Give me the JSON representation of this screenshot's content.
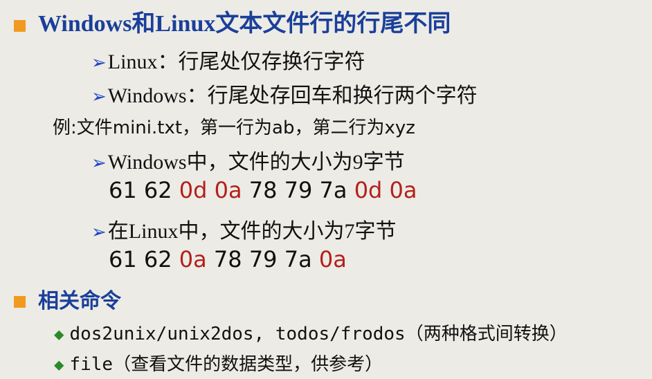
{
  "colors": {
    "background": "#ecebe5",
    "heading": "#1a3f9a",
    "bullet_square": "#f29a1f",
    "arrow": "#1d46c8",
    "diamond": "#2a8a2a",
    "highlight": "#b41f1a"
  },
  "heading1": "Windows和Linux文本文件行的行尾不同",
  "linux_line": "Linux：行尾处仅存换行字符",
  "windows_line": "Windows：行尾处存回车和换行两个字符",
  "example": "例:文件mini.txt，第一行为ab，第二行为xyz",
  "windows_size": "Windows中，文件的大小为9字节",
  "windows_bytes": [
    "61",
    "62",
    "0d",
    "0a",
    "78",
    "79",
    "7a",
    "0d",
    "0a"
  ],
  "linux_size": "在Linux中，文件的大小为7字节",
  "linux_bytes": [
    "61",
    "62",
    "0a",
    "78",
    "79",
    "7a",
    "0a"
  ],
  "heading2": "相关命令",
  "cmd1": "dos2unix/unix2dos, todos/frodos（两种格式间转换）",
  "cmd2": "file（查看文件的数据类型，供参考）"
}
